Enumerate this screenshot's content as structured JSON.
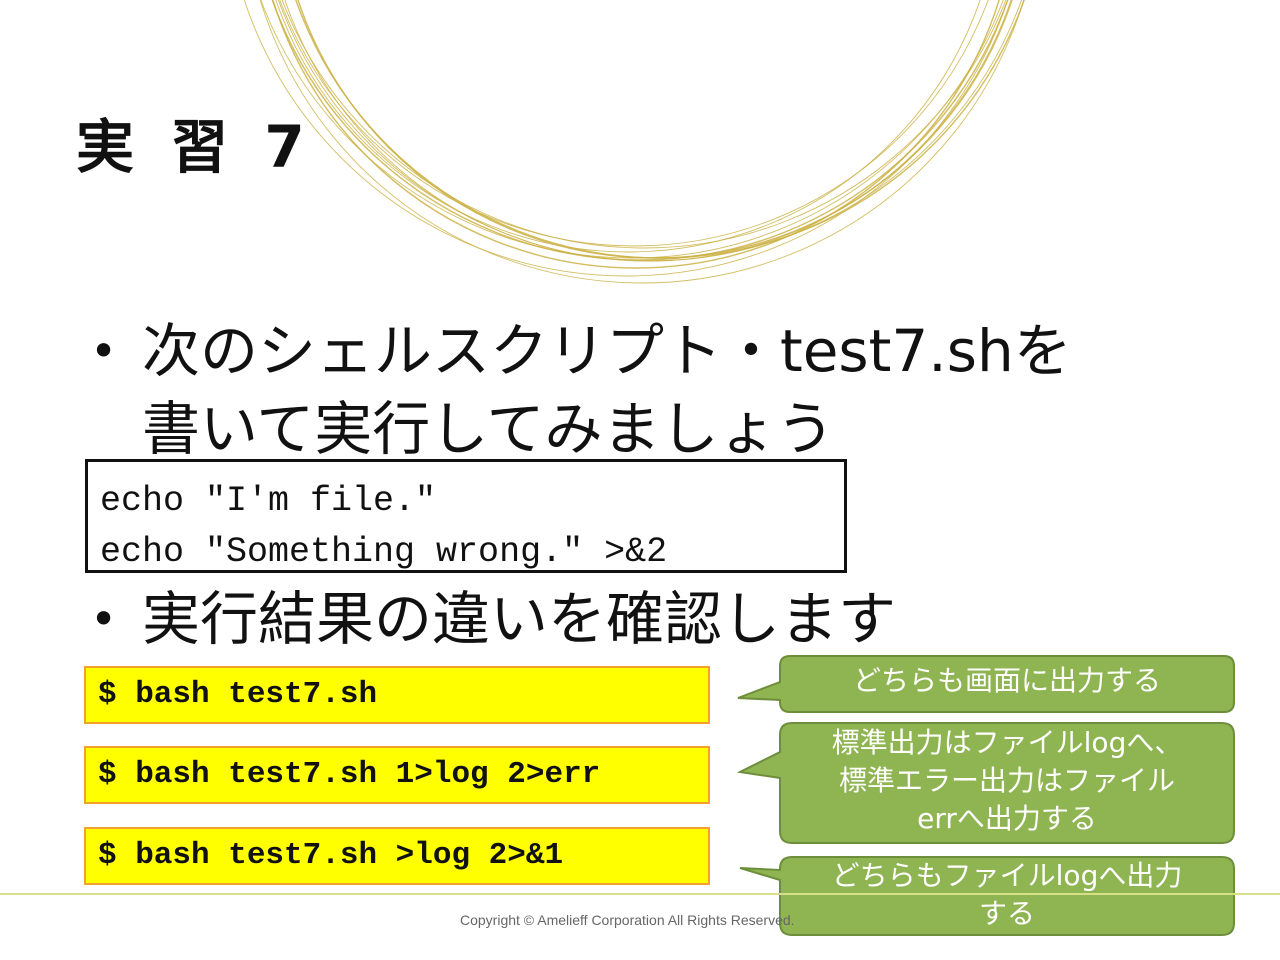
{
  "slide": {
    "title": "実 習 7",
    "bullets": [
      {
        "marker": "•",
        "line1": "次のシェルスクリプト・test7.shを",
        "line2": "書いて実行してみましょう"
      },
      {
        "marker": "•",
        "line1": "実行結果の違いを確認します"
      }
    ],
    "script_lines": [
      "echo \"I'm file.\"",
      "echo \"Something wrong.\" >&2"
    ],
    "commands": [
      "$ bash test7.sh",
      "$ bash test7.sh 1>log 2>err",
      "$ bash test7.sh >log 2>&1"
    ],
    "callouts": [
      {
        "text": "どちらも画面に出力する"
      },
      {
        "line1": "標準出力はファイルlogへ、",
        "line2": "標準エラー出力はファイル",
        "line3": "errへ出力する"
      },
      {
        "line1": "どちらもファイルlogへ出力",
        "line2": "する"
      }
    ],
    "footer": "Copyright © Amelieff Corporation All Rights Reserved."
  },
  "colors": {
    "decoration_rings": "#cbb144",
    "command_fill": "#ffff00",
    "command_border": "#f2a12b",
    "callout_fill": "#8fb452",
    "callout_border": "#6d8e3a"
  }
}
